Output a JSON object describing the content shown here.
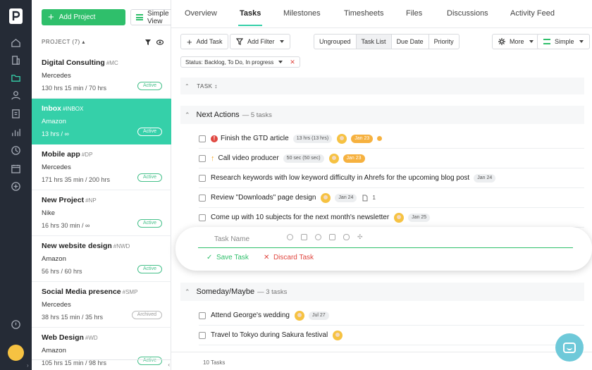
{
  "sidebar": {
    "add_project_label": "Add Project",
    "view_label": "Simple View",
    "section_header": "PROJECT (7) ▴",
    "projects": [
      {
        "name": "Digital Consulting",
        "tag": "#MC",
        "client": "Mercedes",
        "hours": "130 hrs 15 min / 70 hrs",
        "status": "Active"
      },
      {
        "name": "Inbox",
        "tag": "#INBOX",
        "client": "Amazon",
        "hours": "13 hrs / ∞",
        "status": "Active"
      },
      {
        "name": "Mobile app",
        "tag": "#DP",
        "client": "Mercedes",
        "hours": "171 hrs 35 min / 200 hrs",
        "status": "Active"
      },
      {
        "name": "New Project",
        "tag": "#NP",
        "client": "Nike",
        "hours": "16 hrs 30 min / ∞",
        "status": "Active"
      },
      {
        "name": "New website design",
        "tag": "#NWD",
        "client": "Amazon",
        "hours": "56 hrs / 60 hrs",
        "status": "Active"
      },
      {
        "name": "Social Media presence",
        "tag": "#SMP",
        "client": "Mercedes",
        "hours": "38 hrs 15 min / 35 hrs",
        "status": "Archived"
      },
      {
        "name": "Web Design",
        "tag": "#WD",
        "client": "Amazon",
        "hours": "105 hrs 15 min / 98 hrs",
        "status": "Active"
      }
    ],
    "collapse_glyph": "‹"
  },
  "tabs": [
    "Overview",
    "Tasks",
    "Milestones",
    "Timesheets",
    "Files",
    "Discussions",
    "Activity Feed"
  ],
  "toolbar": {
    "add_task": "Add Task",
    "add_filter": "Add Filter",
    "grouping": [
      "Ungrouped",
      "Task List",
      "Due Date",
      "Priority"
    ],
    "more": "More",
    "simple": "Simple"
  },
  "filter_chip": "Status: Backlog, To Do, In progress",
  "column_header": "TASK ↕",
  "sections": [
    {
      "title": "Next Actions",
      "count": "— 5 tasks",
      "tasks": [
        {
          "title": "Finish the GTD article",
          "time": "13 hrs (13 hrs)",
          "date": "Jan 23"
        },
        {
          "title": "Call video producer",
          "time": "50 sec (50 sec)",
          "date": "Jan 23"
        },
        {
          "title": "Research keywords with low keyword difficulty in Ahrefs for the upcoming blog post",
          "date": "Jan 24"
        },
        {
          "title": "Review \"Downloads\" page design",
          "date": "Jan 24",
          "files": "1"
        },
        {
          "title": "Come up with 10 subjects for the next month's newsletter",
          "date": "Jan 25"
        }
      ]
    },
    {
      "title": "Someday/Maybe",
      "count": "— 3 tasks",
      "tasks": [
        {
          "title": "Attend George's wedding",
          "date": "Jul 27"
        },
        {
          "title": "Travel to Tokyo during Sakura festival"
        }
      ]
    }
  ],
  "editor": {
    "placeholder": "Task Name",
    "save": "Save Task",
    "discard": "Discard Task"
  },
  "footer": "10 Tasks",
  "colors": {
    "accent": "#35d0a9",
    "green": "#2fbf6b",
    "red": "#e0463f",
    "orange": "#f6b13f",
    "rail": "#252b36"
  }
}
